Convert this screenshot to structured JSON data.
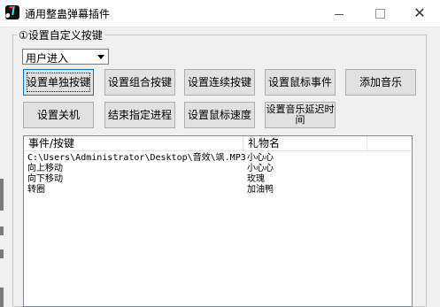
{
  "window": {
    "title": "通用整蛊弹幕插件"
  },
  "group": {
    "title": "①设置自定义按键"
  },
  "combo": {
    "value": "用户进入"
  },
  "buttons_row1": [
    {
      "label": "设置单独按键"
    },
    {
      "label": "设置组合按键"
    },
    {
      "label": "设置连续按键"
    },
    {
      "label": "设置鼠标事件"
    },
    {
      "label": "添加音乐"
    }
  ],
  "buttons_row2": [
    {
      "label": "设置关机"
    },
    {
      "label": "结束指定进程"
    },
    {
      "label": "设置鼠标速度"
    },
    {
      "label": "设置音乐延迟时间"
    }
  ],
  "table": {
    "columns": [
      "事件/按键",
      "礼物名"
    ],
    "rows": [
      {
        "event": "C:\\Users\\Administrator\\Desktop\\音效\\飒.MP3",
        "gift": "小心心"
      },
      {
        "event": "向上移动",
        "gift": "小心心"
      },
      {
        "event": "向下移动",
        "gift": "玫瑰"
      },
      {
        "event": "转圈",
        "gift": "加油鸭"
      }
    ]
  }
}
